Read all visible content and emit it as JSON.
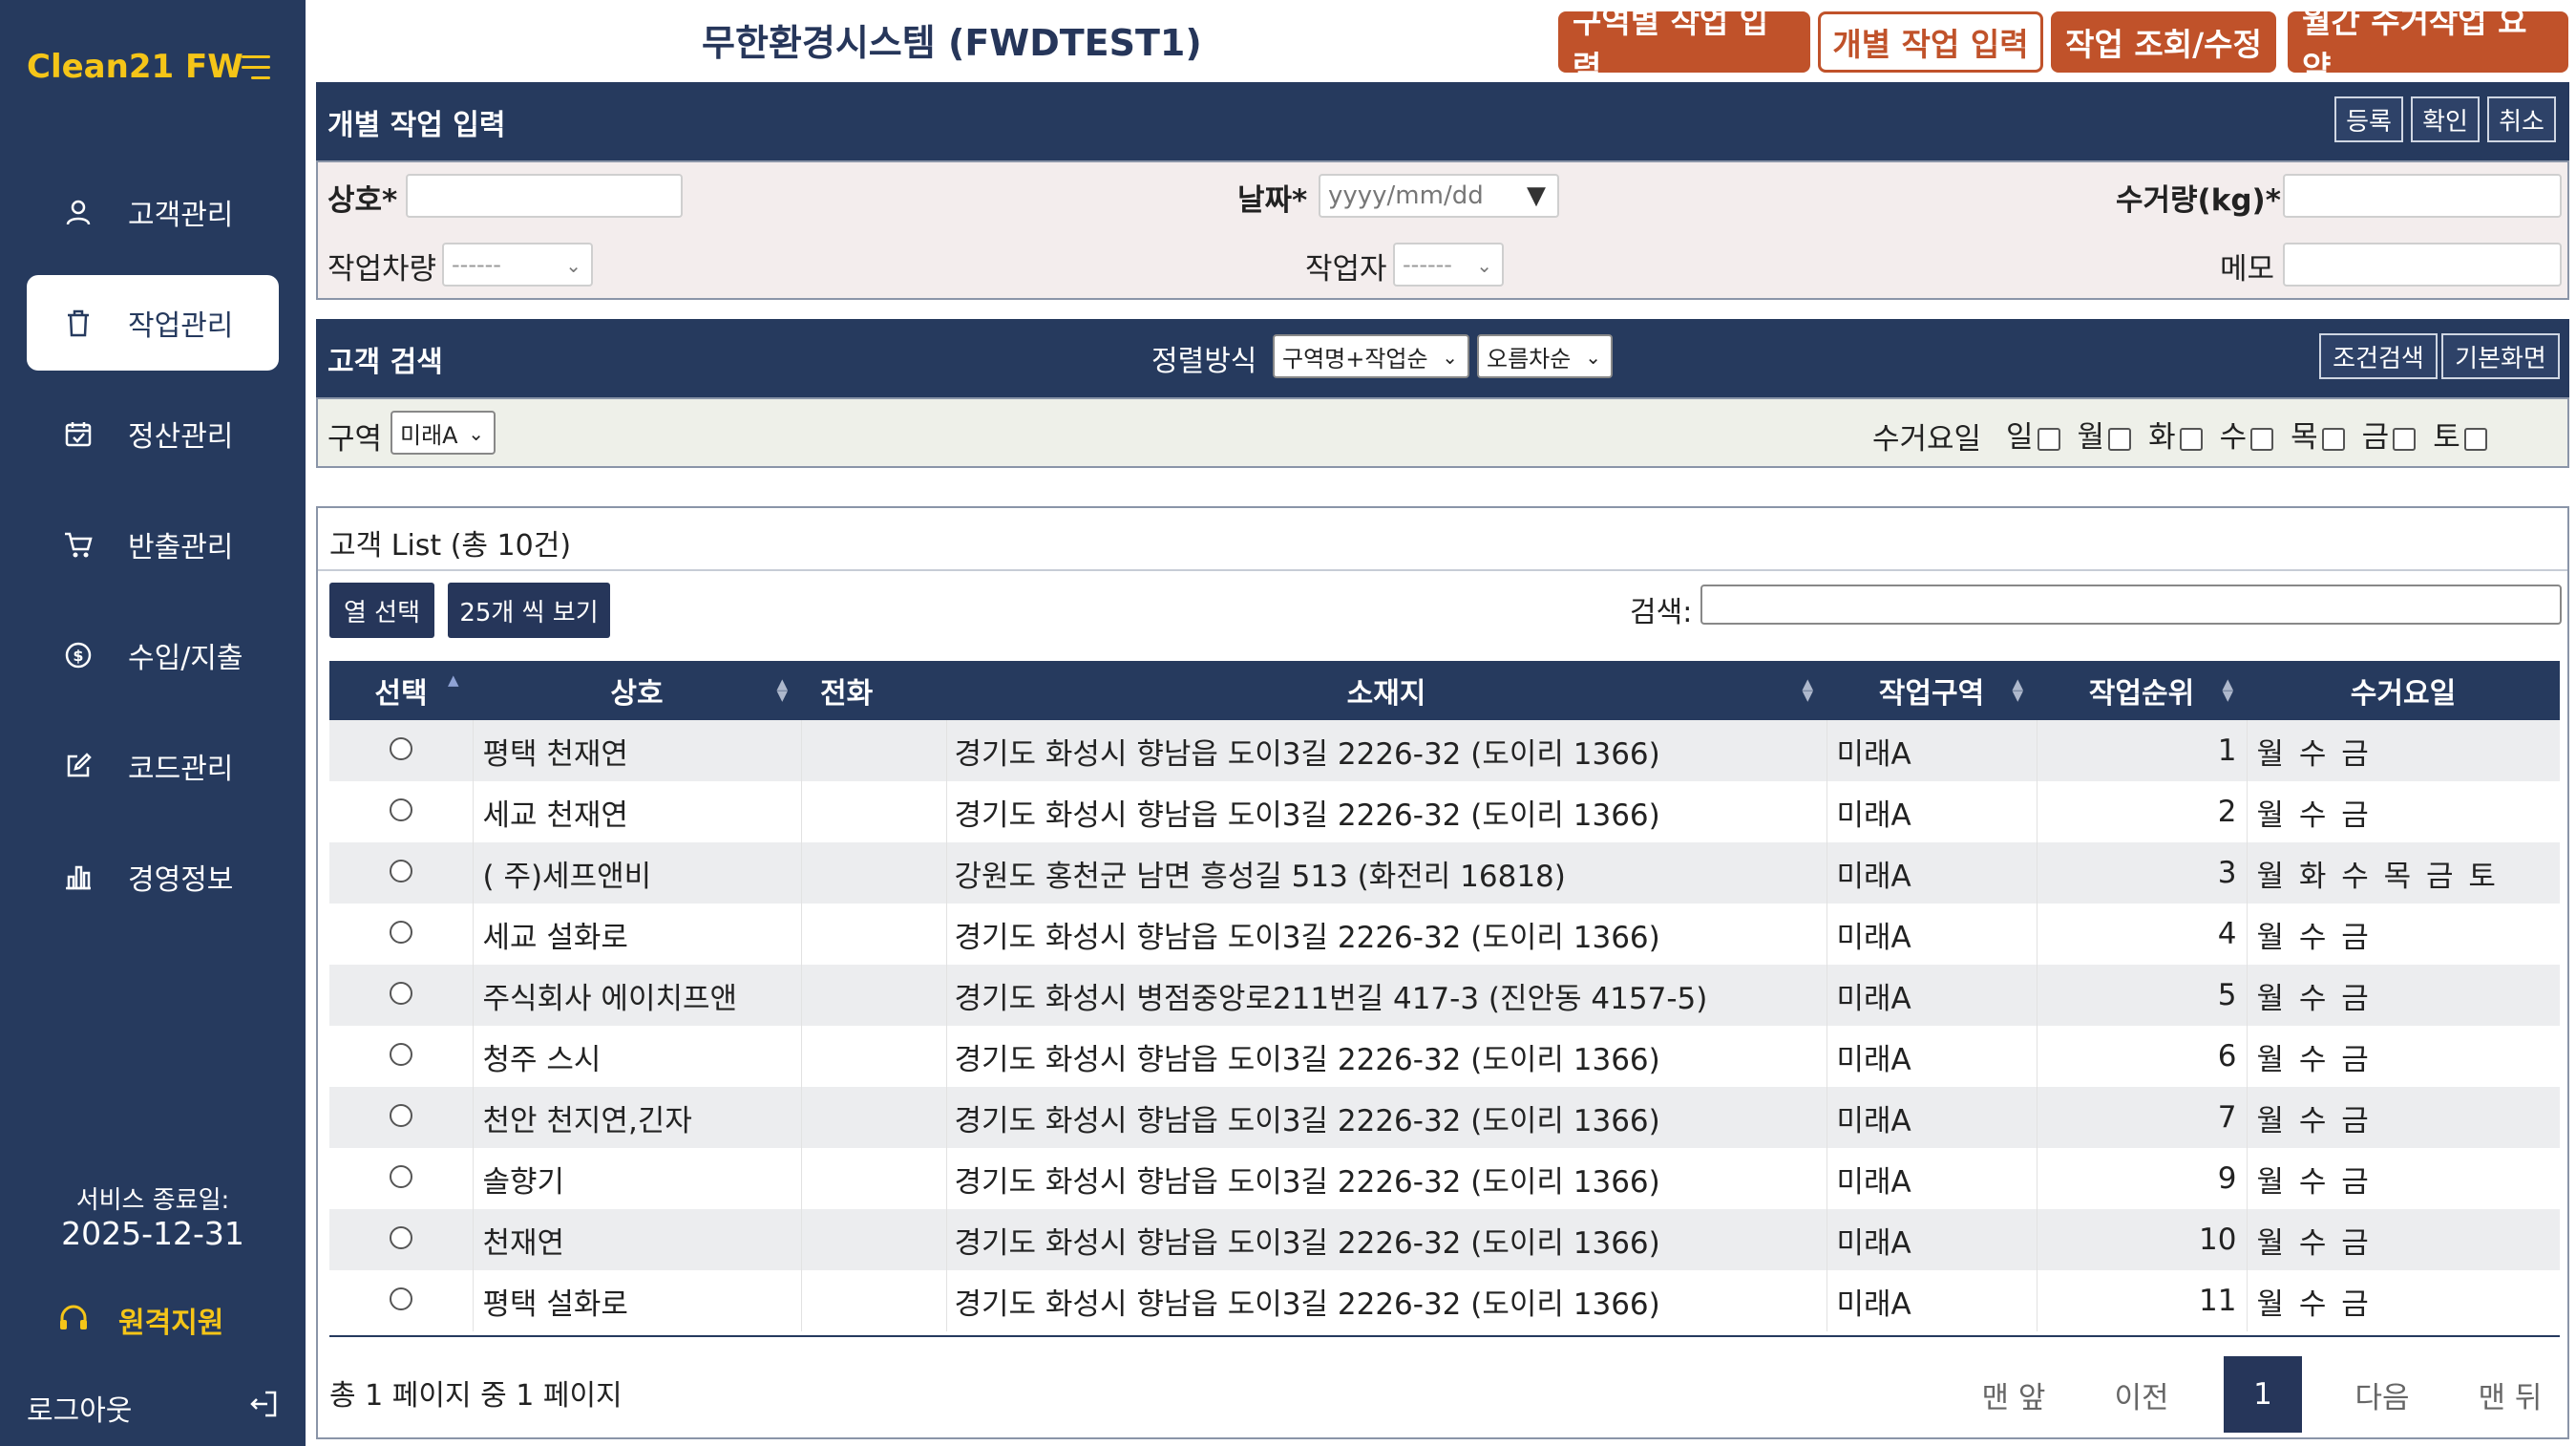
{
  "sidebar": {
    "brand": "Clean21 FW",
    "items": [
      {
        "label": "고객관리",
        "icon": "user-icon"
      },
      {
        "label": "작업관리",
        "icon": "trash-icon"
      },
      {
        "label": "정산관리",
        "icon": "calendar-check-icon"
      },
      {
        "label": "반출관리",
        "icon": "cart-icon"
      },
      {
        "label": "수입/지출",
        "icon": "dollar-icon"
      },
      {
        "label": "코드관리",
        "icon": "edit-icon"
      },
      {
        "label": "경영정보",
        "icon": "bar-chart-icon"
      }
    ],
    "active_index": 1,
    "service_end_label": "서비스 종료일:",
    "service_end_date": "2025-12-31",
    "remote_label": "원격지원",
    "logout_label": "로그아웃"
  },
  "header": {
    "title": "무한환경시스템 (FWDTEST1)",
    "buttons": [
      "구역별 작업 입력",
      "개별 작업 입력",
      "작업 조회/수정",
      "월간 수거작업 요약"
    ]
  },
  "entry_form": {
    "title": "개별 작업 입력",
    "actions": [
      "등록",
      "확인",
      "취소"
    ],
    "name_label": "상호*",
    "date_label": "날짜*",
    "date_placeholder": "yyyy/mm/dd",
    "amount_label": "수거량(kg)*",
    "vehicle_label": "작업차량",
    "vehicle_value": "------",
    "worker_label": "작업자",
    "worker_value": "------",
    "memo_label": "메모"
  },
  "customer_search": {
    "title": "고객 검색",
    "sort_label": "정렬방식",
    "sort_value": "구역명+작업순",
    "order_value": "오름차순",
    "actions": [
      "조건검색",
      "기본화면"
    ],
    "zone_label": "구역",
    "zone_value": "미래A",
    "day_label": "수거요일",
    "days": [
      "일",
      "월",
      "화",
      "수",
      "목",
      "금",
      "토"
    ]
  },
  "list": {
    "title": "고객 List (총 10건)",
    "col_select_btn": "열 선택",
    "page_size_btn": "25개 씩 보기",
    "search_label": "검색:",
    "columns": [
      "선택",
      "상호",
      "전화",
      "소재지",
      "작업구역",
      "작업순위",
      "수거요일"
    ],
    "rows": [
      {
        "name": "평택 천재연",
        "phone": "",
        "address": "경기도 화성시 향남읍 도이3길 2226-32 (도이리 1366)",
        "zone": "미래A",
        "order": "1",
        "days": "월 수 금"
      },
      {
        "name": "세교 천재연",
        "phone": "",
        "address": "경기도 화성시 향남읍 도이3길 2226-32 (도이리 1366)",
        "zone": "미래A",
        "order": "2",
        "days": "월 수 금"
      },
      {
        "name": "( 주)세프앤비",
        "phone": "",
        "address": "강원도 홍천군 남면 흥성길 513 (화전리 16818)",
        "zone": "미래A",
        "order": "3",
        "days": "월 화 수 목 금 토"
      },
      {
        "name": "세교 설화로",
        "phone": "",
        "address": "경기도 화성시 향남읍 도이3길 2226-32 (도이리 1366)",
        "zone": "미래A",
        "order": "4",
        "days": "월 수 금"
      },
      {
        "name": "주식회사 에이치프앤",
        "phone": "",
        "address": "경기도 화성시 병점중앙로211번길 417-3 (진안동 4157-5)",
        "zone": "미래A",
        "order": "5",
        "days": "월 수 금"
      },
      {
        "name": "청주 스시",
        "phone": "",
        "address": "경기도 화성시 향남읍 도이3길 2226-32 (도이리 1366)",
        "zone": "미래A",
        "order": "6",
        "days": "월 수 금"
      },
      {
        "name": "천안 천지연,긴자",
        "phone": "",
        "address": "경기도 화성시 향남읍 도이3길 2226-32 (도이리 1366)",
        "zone": "미래A",
        "order": "7",
        "days": "월 수 금"
      },
      {
        "name": "솔향기",
        "phone": "",
        "address": "경기도 화성시 향남읍 도이3길 2226-32 (도이리 1366)",
        "zone": "미래A",
        "order": "9",
        "days": "월 수 금"
      },
      {
        "name": "천재연",
        "phone": "",
        "address": "경기도 화성시 향남읍 도이3길 2226-32 (도이리 1366)",
        "zone": "미래A",
        "order": "10",
        "days": "월 수 금"
      },
      {
        "name": "평택 설화로",
        "phone": "",
        "address": "경기도 화성시 향남읍 도이3길 2226-32 (도이리 1366)",
        "zone": "미래A",
        "order": "11",
        "days": "월 수 금"
      }
    ],
    "pager_info": "총 1 페이지 중 1 페이지",
    "pager": {
      "first": "맨 앞",
      "prev": "이전",
      "current": "1",
      "next": "다음",
      "last": "맨 뒤"
    }
  },
  "colors": {
    "navy": "#263a5e",
    "accent": "#c0522a",
    "brand_yellow": "#f5c518"
  }
}
